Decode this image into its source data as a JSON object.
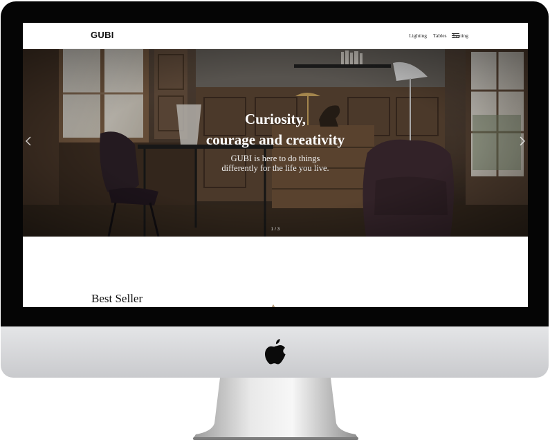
{
  "header": {
    "logo": "GUBI",
    "nav": [
      "Lighting",
      "Tables",
      "Seating"
    ],
    "menu_icon": "hamburger-menu-icon"
  },
  "hero": {
    "title_line1": "Curiosity,",
    "title_line2": "courage and creativity",
    "subtitle_line1": "GUBI is here to do things",
    "subtitle_line2": "differently for the life you live.",
    "pager": "1 / 3",
    "prev_icon": "chevron-left-icon",
    "next_icon": "chevron-right-icon"
  },
  "section": {
    "title": "Best Seller"
  },
  "device": {
    "logo_icon": "apple-logo-icon"
  }
}
